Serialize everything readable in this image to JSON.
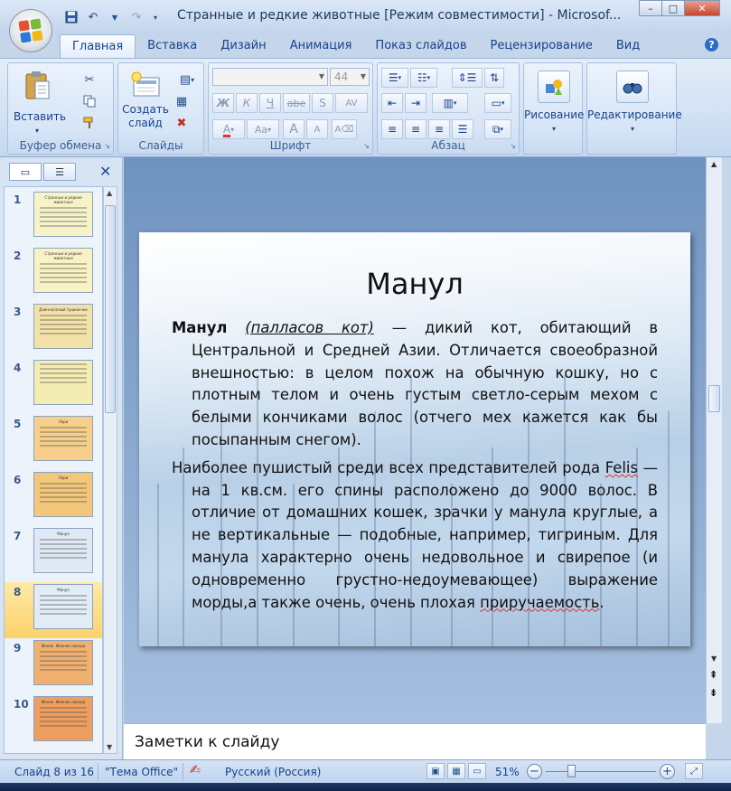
{
  "window": {
    "title": "Странные и редкие животные [Режим совместимости] - Microsof...",
    "minimize": "–",
    "maximize": "□",
    "close": "✕"
  },
  "ribbon_tabs": [
    "Главная",
    "Вставка",
    "Дизайн",
    "Анимация",
    "Показ слайдов",
    "Рецензирование",
    "Вид"
  ],
  "ribbon": {
    "clipboard": {
      "label": "Буфер обмена",
      "paste": "Вставить"
    },
    "slides": {
      "label": "Слайды",
      "new_slide_line1": "Создать",
      "new_slide_line2": "слайд"
    },
    "font": {
      "label": "Шрифт",
      "size": "44",
      "bold": "Ж",
      "italic": "К",
      "underline": "Ч",
      "strike": "abe",
      "shadow": "S",
      "spacing": "AV",
      "grow": "A",
      "shrink": "A",
      "case": "Aa",
      "clear": "A"
    },
    "paragraph": {
      "label": "Абзац"
    },
    "drawing": {
      "label": "Рисование"
    },
    "editing": {
      "label": "Редактирование"
    }
  },
  "thumbnails": [
    {
      "num": "1",
      "bg": "#f7f3c8",
      "title": "Странные и редкие животные"
    },
    {
      "num": "2",
      "bg": "#f8f2c4",
      "title": "Странные и редкие животные"
    },
    {
      "num": "3",
      "bg": "#f3e2a8",
      "title": "Длиннопалый тушканчик"
    },
    {
      "num": "4",
      "bg": "#f4edb3",
      "title": ""
    },
    {
      "num": "5",
      "bg": "#f6d08a",
      "title": "Лори"
    },
    {
      "num": "6",
      "bg": "#f3c779",
      "title": "Лори"
    },
    {
      "num": "7",
      "bg": "#dfe9f5",
      "title": "Манул"
    },
    {
      "num": "8",
      "bg": "#e2ecf6",
      "title": "Манул"
    },
    {
      "num": "9",
      "bg": "#f0b070",
      "title": "Фенек. Феннек лисица"
    },
    {
      "num": "10",
      "bg": "#ee9f60",
      "title": "Фенек. Феннек лисица"
    }
  ],
  "slide": {
    "title": "Манул",
    "p1_bold": "Манул",
    "p1_italic": "(палласов кот)",
    "p1_text": " — дикий кот, обитающий в Центральной и Средней Азии. Отличается своеобразной внешностью: в целом похож на обычную кошку, но с плотным телом и очень густым светло-серым мехом с белыми кончиками волос (отчего мех кажется как бы посыпанным снегом).",
    "p2_a": "Наиболее пушистый среди всех представителей рода ",
    "p2_felis": "Felis",
    "p2_b": " — на 1 кв.см. его спины расположено до 9000 волос. В отличие от домашних кошек, зрачки у манула круглые, а не вертикальные — подобные, например, тигриным. Для манула характерно очень недовольное и свирепое (и одновременно грустно-недоумевающее) выражение морды,а также очень, очень плохая ",
    "p2_c": "приручаемость",
    "p2_d": "."
  },
  "notes_placeholder": "Заметки к слайду",
  "status": {
    "slide_counter": "Слайд 8 из 16",
    "theme": "\"Тема Office\"",
    "language": "Русский (Россия)",
    "zoom": "51%"
  },
  "icons": [
    "office-logo-icon",
    "save-icon",
    "undo-icon",
    "redo-icon",
    "paste-icon",
    "cut-icon",
    "copy-icon",
    "format-painter-icon",
    "new-slide-icon",
    "layout-icon",
    "reset-icon",
    "delete-icon",
    "bullets-icon",
    "numbering-icon",
    "align-left-icon",
    "center-icon",
    "align-right-icon",
    "justify-icon",
    "shapes-icon",
    "find-icon",
    "slides-tab-icon",
    "outline-tab-icon",
    "close-panel-icon",
    "spell-check-icon",
    "normal-view-icon",
    "sorter-view-icon",
    "slideshow-icon",
    "fit-icon"
  ]
}
